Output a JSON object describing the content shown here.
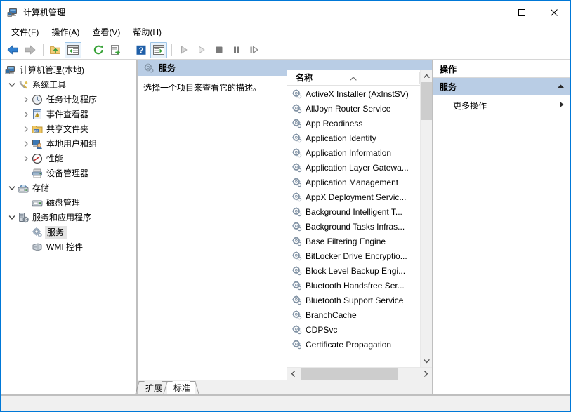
{
  "window": {
    "title": "计算机管理",
    "icon": "computer-management-icon",
    "controls": {
      "minimize": "最小化",
      "maximize": "最大化",
      "close": "关闭"
    }
  },
  "menubar": {
    "items": [
      {
        "label": "文件(F)",
        "name": "menu-file"
      },
      {
        "label": "操作(A)",
        "name": "menu-action"
      },
      {
        "label": "查看(V)",
        "name": "menu-view"
      },
      {
        "label": "帮助(H)",
        "name": "menu-help"
      }
    ]
  },
  "toolbar": {
    "buttons": [
      {
        "name": "back-button",
        "icon": "arrow-left-icon",
        "enabled": true
      },
      {
        "name": "forward-button",
        "icon": "arrow-right-icon",
        "enabled": false
      },
      {
        "sep": true
      },
      {
        "name": "up-one-level-button",
        "icon": "folder-up-icon",
        "enabled": true
      },
      {
        "name": "show-hide-console-tree-button",
        "icon": "console-tree-icon",
        "framed": true
      },
      {
        "sep": true
      },
      {
        "name": "refresh-button",
        "icon": "refresh-icon",
        "enabled": true
      },
      {
        "name": "export-list-button",
        "icon": "export-list-icon",
        "enabled": true
      },
      {
        "sep": true
      },
      {
        "name": "help-button",
        "icon": "help-icon",
        "enabled": true
      },
      {
        "name": "show-hide-action-pane-button",
        "icon": "action-pane-icon",
        "framed": true
      },
      {
        "sep": true
      },
      {
        "name": "start-service-button",
        "icon": "play-icon",
        "enabled": false
      },
      {
        "name": "resume-service-button",
        "icon": "play-outline-icon",
        "enabled": false
      },
      {
        "name": "stop-service-button",
        "icon": "stop-icon",
        "enabled": false
      },
      {
        "name": "pause-service-button",
        "icon": "pause-icon",
        "enabled": false
      },
      {
        "name": "restart-service-button",
        "icon": "restart-icon",
        "enabled": false
      }
    ]
  },
  "tree": {
    "nodes": [
      {
        "label": "计算机管理(本地)",
        "icon": "computer-icon",
        "indent": 0,
        "chevron": "none",
        "selected": false
      },
      {
        "label": "系统工具",
        "icon": "system-tools-icon",
        "indent": 1,
        "chevron": "expanded",
        "selected": false
      },
      {
        "label": "任务计划程序",
        "icon": "task-scheduler-icon",
        "indent": 2,
        "chevron": "collapsed",
        "selected": false
      },
      {
        "label": "事件查看器",
        "icon": "event-viewer-icon",
        "indent": 2,
        "chevron": "collapsed",
        "selected": false
      },
      {
        "label": "共享文件夹",
        "icon": "shared-folders-icon",
        "indent": 2,
        "chevron": "collapsed",
        "selected": false
      },
      {
        "label": "本地用户和组",
        "icon": "local-users-groups-icon",
        "indent": 2,
        "chevron": "collapsed",
        "selected": false
      },
      {
        "label": "性能",
        "icon": "performance-icon",
        "indent": 2,
        "chevron": "collapsed",
        "selected": false
      },
      {
        "label": "设备管理器",
        "icon": "device-manager-icon",
        "indent": 2,
        "chevron": "none",
        "selected": false
      },
      {
        "label": "存储",
        "icon": "storage-icon",
        "indent": 1,
        "chevron": "expanded",
        "selected": false
      },
      {
        "label": "磁盘管理",
        "icon": "disk-management-icon",
        "indent": 2,
        "chevron": "none",
        "selected": false
      },
      {
        "label": "服务和应用程序",
        "icon": "services-applications-icon",
        "indent": 1,
        "chevron": "expanded",
        "selected": false
      },
      {
        "label": "服务",
        "icon": "services-icon",
        "indent": 2,
        "chevron": "none",
        "selected": true
      },
      {
        "label": "WMI 控件",
        "icon": "wmi-control-icon",
        "indent": 2,
        "chevron": "none",
        "selected": false
      }
    ]
  },
  "details": {
    "header": "服务",
    "header_icon": "services-gear-icon",
    "description": "选择一个项目来查看它的描述。"
  },
  "list": {
    "column_header": "名称",
    "sort": "ascending",
    "rows": [
      {
        "name": "ActiveX Installer (AxInstSV)"
      },
      {
        "name": "AllJoyn Router Service"
      },
      {
        "name": "App Readiness"
      },
      {
        "name": "Application Identity"
      },
      {
        "name": "Application Information"
      },
      {
        "name": "Application Layer Gatewa..."
      },
      {
        "name": "Application Management"
      },
      {
        "name": "AppX Deployment Servic..."
      },
      {
        "name": "Background Intelligent T..."
      },
      {
        "name": "Background Tasks Infras..."
      },
      {
        "name": "Base Filtering Engine"
      },
      {
        "name": "BitLocker Drive Encryptio..."
      },
      {
        "name": "Block Level Backup Engi..."
      },
      {
        "name": "Bluetooth Handsfree Ser..."
      },
      {
        "name": "Bluetooth Support Service"
      },
      {
        "name": "BranchCache"
      },
      {
        "name": "CDPSvc"
      },
      {
        "name": "Certificate Propagation"
      }
    ]
  },
  "tabs": [
    {
      "label": "扩展",
      "active": false,
      "name": "tab-extended"
    },
    {
      "label": "标准",
      "active": true,
      "name": "tab-standard"
    }
  ],
  "actions": {
    "title": "操作",
    "section": "服务",
    "section_state": "expanded",
    "items": [
      {
        "label": "更多操作",
        "has_submenu": true,
        "name": "action-more-actions"
      }
    ]
  },
  "colors": {
    "window_border": "#0078d7",
    "header_band": "#b9cde5",
    "scrollbar_thumb": "#cdcdcd",
    "pane_border": "#bfbfbf",
    "selection": "#e4e4e4"
  }
}
